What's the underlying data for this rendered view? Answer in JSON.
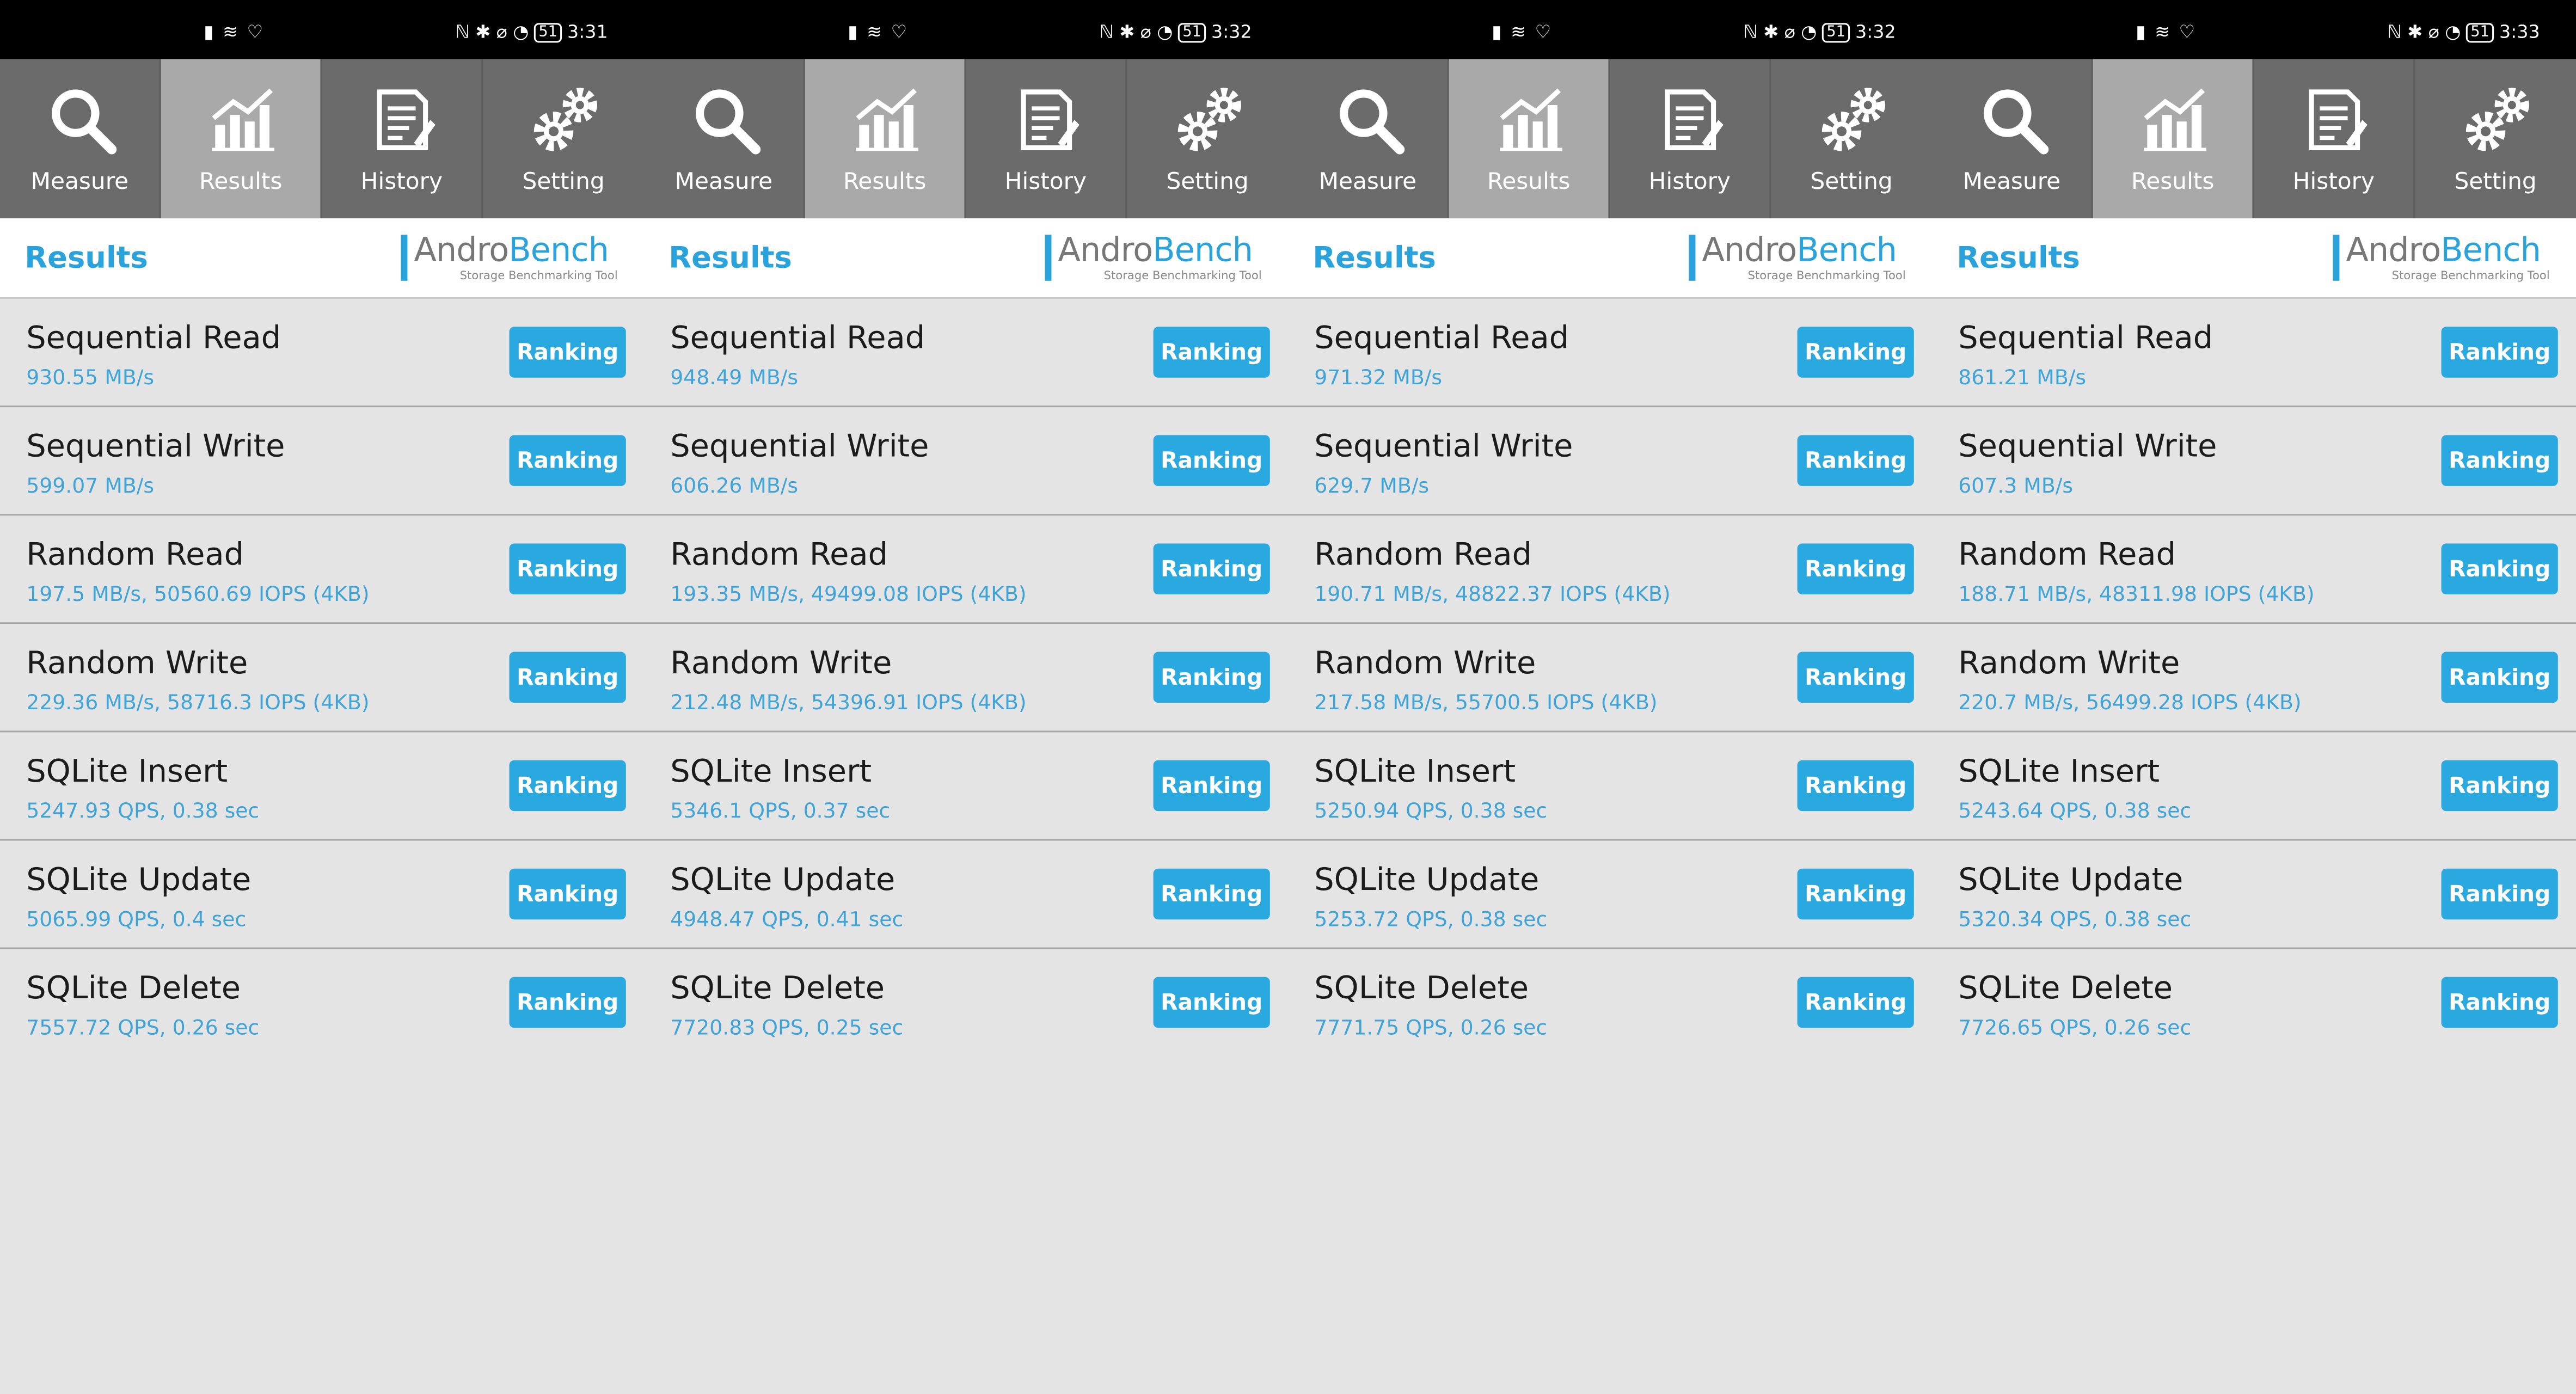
{
  "colors": {
    "accent": "#2aa3dd",
    "nav_bg": "#6b6b6b",
    "nav_active": "#a9a9a9",
    "content_bg": "#e4e4e4",
    "value_text": "#3ea3d6"
  },
  "screens": [
    {
      "status": {
        "left_icons": "▮ ≋ ♡",
        "right_icons": "ℕ ✱ ⌀ ◔",
        "battery": "51",
        "time": "3:31"
      },
      "nav": [
        {
          "label": "Measure",
          "icon": "search-icon"
        },
        {
          "label": "Results",
          "icon": "chart-icon"
        },
        {
          "label": "History",
          "icon": "document-icon"
        },
        {
          "label": "Setting",
          "icon": "gear-icon"
        }
      ],
      "header": {
        "title": "Results",
        "logo_andro": "Andro",
        "logo_bench": "Bench",
        "logo_tagline": "Storage Benchmarking Tool"
      },
      "results": [
        {
          "name": "Sequential Read",
          "value": "930.55 MB/s",
          "button": "Ranking"
        },
        {
          "name": "Sequential Write",
          "value": "599.07 MB/s",
          "button": "Ranking"
        },
        {
          "name": "Random Read",
          "value": "197.5 MB/s, 50560.69 IOPS (4KB)",
          "button": "Ranking"
        },
        {
          "name": "Random Write",
          "value": "229.36 MB/s, 58716.3 IOPS (4KB)",
          "button": "Ranking"
        },
        {
          "name": "SQLite Insert",
          "value": "5247.93 QPS, 0.38 sec",
          "button": "Ranking"
        },
        {
          "name": "SQLite Update",
          "value": "5065.99 QPS, 0.4 sec",
          "button": "Ranking"
        },
        {
          "name": "SQLite Delete",
          "value": "7557.72 QPS, 0.26 sec",
          "button": "Ranking"
        }
      ]
    },
    {
      "status": {
        "left_icons": "▮ ≋ ♡",
        "right_icons": "ℕ ✱ ⌀ ◔",
        "battery": "51",
        "time": "3:32"
      },
      "nav": [
        {
          "label": "Measure",
          "icon": "search-icon"
        },
        {
          "label": "Results",
          "icon": "chart-icon"
        },
        {
          "label": "History",
          "icon": "document-icon"
        },
        {
          "label": "Setting",
          "icon": "gear-icon"
        }
      ],
      "header": {
        "title": "Results",
        "logo_andro": "Andro",
        "logo_bench": "Bench",
        "logo_tagline": "Storage Benchmarking Tool"
      },
      "results": [
        {
          "name": "Sequential Read",
          "value": "948.49 MB/s",
          "button": "Ranking"
        },
        {
          "name": "Sequential Write",
          "value": "606.26 MB/s",
          "button": "Ranking"
        },
        {
          "name": "Random Read",
          "value": "193.35 MB/s, 49499.08 IOPS (4KB)",
          "button": "Ranking"
        },
        {
          "name": "Random Write",
          "value": "212.48 MB/s, 54396.91 IOPS (4KB)",
          "button": "Ranking"
        },
        {
          "name": "SQLite Insert",
          "value": "5346.1 QPS, 0.37 sec",
          "button": "Ranking"
        },
        {
          "name": "SQLite Update",
          "value": "4948.47 QPS, 0.41 sec",
          "button": "Ranking"
        },
        {
          "name": "SQLite Delete",
          "value": "7720.83 QPS, 0.25 sec",
          "button": "Ranking"
        }
      ]
    },
    {
      "status": {
        "left_icons": "▮ ≋ ♡",
        "right_icons": "ℕ ✱ ⌀ ◔",
        "battery": "51",
        "time": "3:32"
      },
      "nav": [
        {
          "label": "Measure",
          "icon": "search-icon"
        },
        {
          "label": "Results",
          "icon": "chart-icon"
        },
        {
          "label": "History",
          "icon": "document-icon"
        },
        {
          "label": "Setting",
          "icon": "gear-icon"
        }
      ],
      "header": {
        "title": "Results",
        "logo_andro": "Andro",
        "logo_bench": "Bench",
        "logo_tagline": "Storage Benchmarking Tool"
      },
      "results": [
        {
          "name": "Sequential Read",
          "value": "971.32 MB/s",
          "button": "Ranking"
        },
        {
          "name": "Sequential Write",
          "value": "629.7 MB/s",
          "button": "Ranking"
        },
        {
          "name": "Random Read",
          "value": "190.71 MB/s, 48822.37 IOPS (4KB)",
          "button": "Ranking"
        },
        {
          "name": "Random Write",
          "value": "217.58 MB/s, 55700.5 IOPS (4KB)",
          "button": "Ranking"
        },
        {
          "name": "SQLite Insert",
          "value": "5250.94 QPS, 0.38 sec",
          "button": "Ranking"
        },
        {
          "name": "SQLite Update",
          "value": "5253.72 QPS, 0.38 sec",
          "button": "Ranking"
        },
        {
          "name": "SQLite Delete",
          "value": "7771.75 QPS, 0.26 sec",
          "button": "Ranking"
        }
      ]
    },
    {
      "status": {
        "left_icons": "▮ ≋ ♡",
        "right_icons": "ℕ ✱ ⌀ ◔",
        "battery": "51",
        "time": "3:33"
      },
      "nav": [
        {
          "label": "Measure",
          "icon": "search-icon"
        },
        {
          "label": "Results",
          "icon": "chart-icon"
        },
        {
          "label": "History",
          "icon": "document-icon"
        },
        {
          "label": "Setting",
          "icon": "gear-icon"
        }
      ],
      "header": {
        "title": "Results",
        "logo_andro": "Andro",
        "logo_bench": "Bench",
        "logo_tagline": "Storage Benchmarking Tool"
      },
      "results": [
        {
          "name": "Sequential Read",
          "value": "861.21 MB/s",
          "button": "Ranking"
        },
        {
          "name": "Sequential Write",
          "value": "607.3 MB/s",
          "button": "Ranking"
        },
        {
          "name": "Random Read",
          "value": "188.71 MB/s, 48311.98 IOPS (4KB)",
          "button": "Ranking"
        },
        {
          "name": "Random Write",
          "value": "220.7 MB/s, 56499.28 IOPS (4KB)",
          "button": "Ranking"
        },
        {
          "name": "SQLite Insert",
          "value": "5243.64 QPS, 0.38 sec",
          "button": "Ranking"
        },
        {
          "name": "SQLite Update",
          "value": "5320.34 QPS, 0.38 sec",
          "button": "Ranking"
        },
        {
          "name": "SQLite Delete",
          "value": "7726.65 QPS, 0.26 sec",
          "button": "Ranking"
        }
      ]
    }
  ]
}
